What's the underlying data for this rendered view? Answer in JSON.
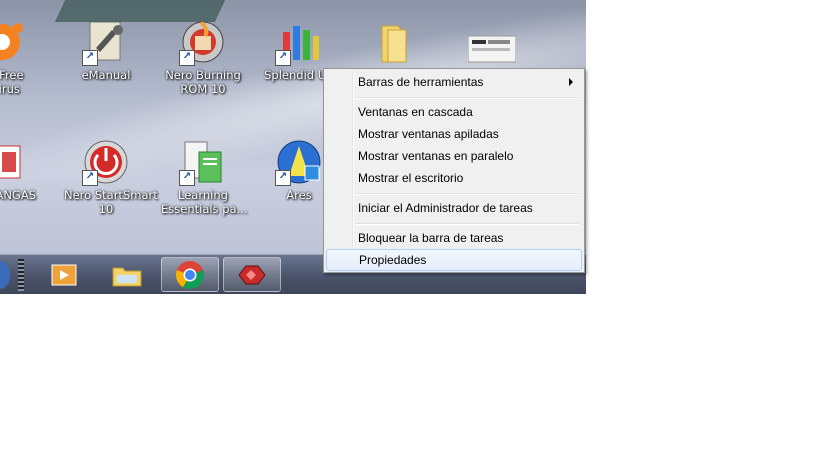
{
  "desktop": {
    "icons": [
      {
        "label": "st! Free\ntivirus",
        "name": "avast-icon"
      },
      {
        "label": "eManual",
        "name": "emanual-icon"
      },
      {
        "label": "Nero Burning\nROM 10",
        "name": "nero-burning-rom-icon"
      },
      {
        "label": "Splendid Uti",
        "name": "splendid-utility-icon"
      },
      {
        "label": "",
        "name": "folder-icon"
      },
      {
        "label": "",
        "name": "screenshot-file-icon"
      },
      {
        "label": "RANGAS",
        "name": "rangas-icon"
      },
      {
        "label": "Nero StartSmart\n10",
        "name": "nero-startsmart-icon"
      },
      {
        "label": "Learning\nEssentials pa...",
        "name": "learning-essentials-icon"
      },
      {
        "label": "Ares",
        "name": "ares-icon"
      }
    ]
  },
  "taskbar": {
    "buttons": [
      "media-player-icon",
      "file-explorer-icon",
      "chrome-icon",
      "red-app-icon"
    ]
  },
  "context_menu": {
    "toolbars": "Barras de herramientas",
    "cascade": "Ventanas en cascada",
    "stacked": "Mostrar ventanas apiladas",
    "side_by_side": "Mostrar ventanas en paralelo",
    "show_desktop": "Mostrar el escritorio",
    "task_manager": "Iniciar el Administrador de tareas",
    "lock_taskbar": "Bloquear la barra de tareas",
    "properties": "Propiedades"
  },
  "colors": {
    "menu_bg": "#f0f0f0",
    "menu_hover": "#e3edfa",
    "taskbar": "#4c556c"
  }
}
